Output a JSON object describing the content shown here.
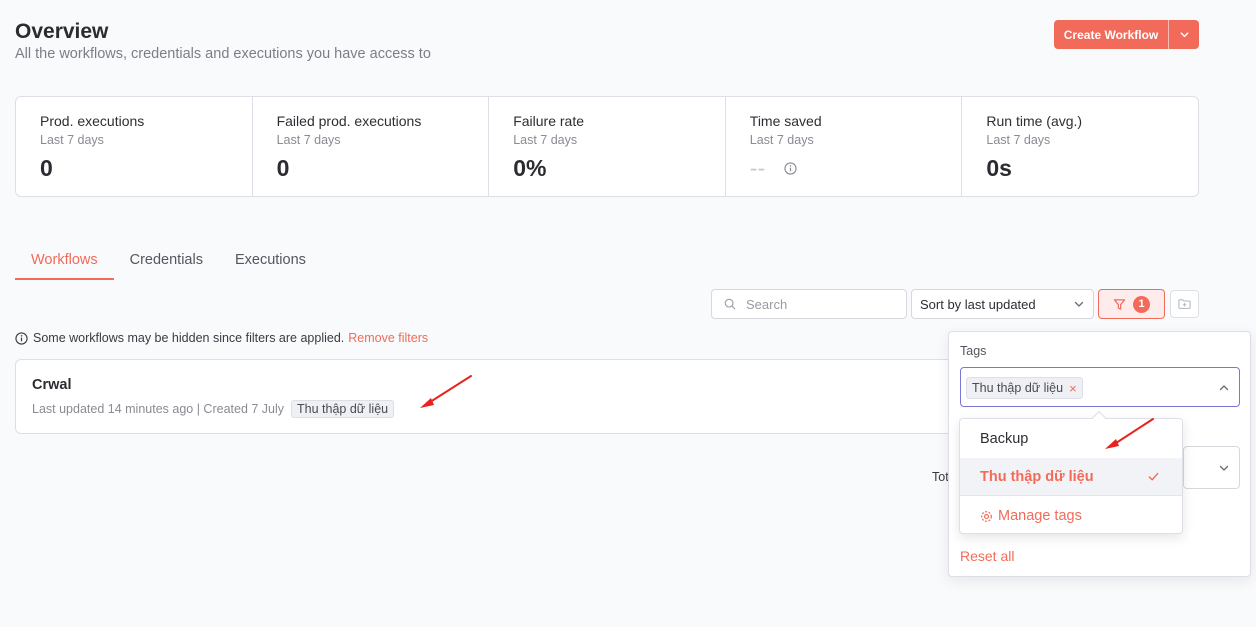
{
  "header": {
    "title": "Overview",
    "subtitle": "All the workflows, credentials and executions you have access to",
    "create_button": "Create Workflow"
  },
  "stats": [
    {
      "label": "Prod. executions",
      "period": "Last 7 days",
      "value": "0"
    },
    {
      "label": "Failed prod. executions",
      "period": "Last 7 days",
      "value": "0"
    },
    {
      "label": "Failure rate",
      "period": "Last 7 days",
      "value": "0%"
    },
    {
      "label": "Time saved",
      "period": "Last 7 days",
      "value": "--"
    },
    {
      "label": "Run time (avg.)",
      "period": "Last 7 days",
      "value": "0s"
    }
  ],
  "tabs": [
    {
      "label": "Workflows",
      "active": true
    },
    {
      "label": "Credentials",
      "active": false
    },
    {
      "label": "Executions",
      "active": false
    }
  ],
  "toolbar": {
    "search_placeholder": "Search",
    "sort_value": "Sort by last updated",
    "filter_count": "1"
  },
  "notice": {
    "text": "Some workflows may be hidden since filters are applied.",
    "link": "Remove filters"
  },
  "workflows": [
    {
      "name": "Crwal",
      "meta": "Last updated 14 minutes ago | Created 7 July",
      "tag": "Thu thập dữ liệu"
    }
  ],
  "pagination_partial": "Tot",
  "filter_popover": {
    "tags_label": "Tags",
    "selected_tag": "Thu thập dữ liệu",
    "reset_label": "Reset all"
  },
  "tags_dropdown": {
    "items": [
      "Backup",
      "Thu thập dữ liệu"
    ],
    "manage_label": "Manage tags"
  },
  "colors": {
    "accent": "#f26b5a",
    "focus_border": "#7b77d9",
    "annotation_arrow": "#e8231f"
  }
}
